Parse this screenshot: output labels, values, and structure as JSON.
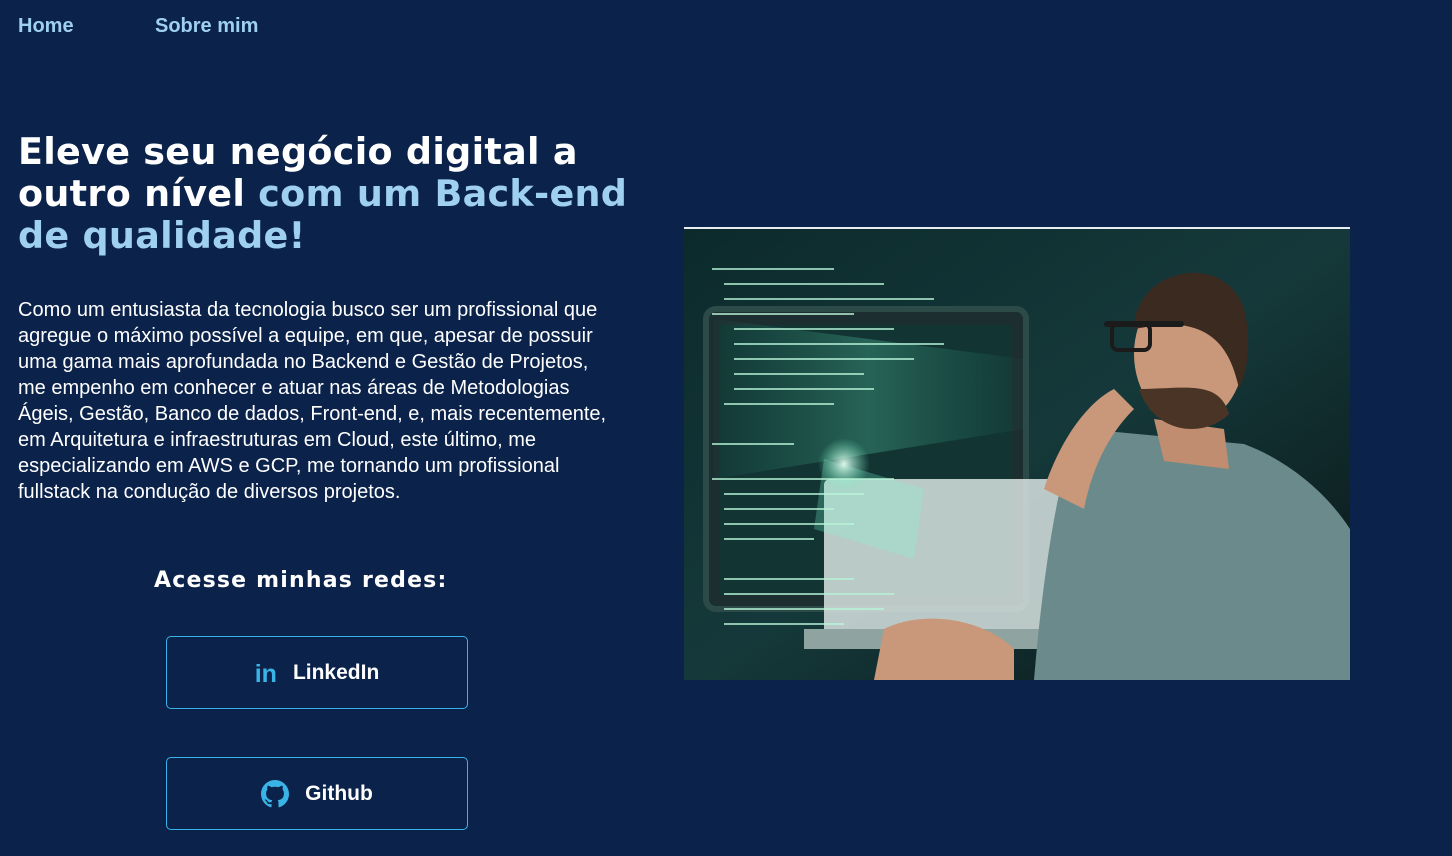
{
  "nav": {
    "home": "Home",
    "about": "Sobre mim"
  },
  "hero": {
    "title_plain": "Eleve seu negócio digital a outro nível",
    "title_accent": "com um Back-end de qualidade!",
    "intro": "Como um entusiasta da tecnologia busco ser um profissional que agregue o máximo possível a equipe, em que, apesar de possuir uma gama mais aprofundada no Backend e Gestão de Projetos, me empenho em conhecer e atuar nas áreas de Metodologias Ágeis, Gestão, Banco de dados, Front-end, e, mais recentemente, em Arquitetura e infraestruturas em Cloud, este último, me especializando em AWS e GCP, me tornando um profissional fullstack na condução de diversos projetos."
  },
  "networks": {
    "title": "Acesse minhas redes:",
    "linkedin_label": "LinkedIn",
    "linkedin_icon": "linkedin-icon",
    "github_label": "Github",
    "github_icon": "github-icon"
  },
  "colors": {
    "background": "#0b224b",
    "accent": "#9fd0ef",
    "button_border": "#3ab4e6"
  }
}
